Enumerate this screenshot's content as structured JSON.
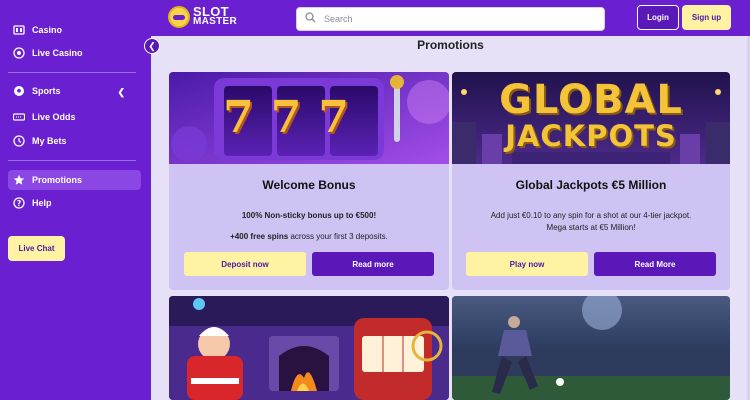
{
  "brand": {
    "line1": "SLOT",
    "line2": "MASTER"
  },
  "search": {
    "placeholder": "Search"
  },
  "auth": {
    "login_label": "Login",
    "signup_label": "Sign up"
  },
  "sidebar": {
    "items": [
      {
        "label": "Casino",
        "icon": "slot-machine-icon"
      },
      {
        "label": "Live Casino",
        "icon": "chip-icon"
      },
      {
        "label": "Sports",
        "icon": "soccer-ball-icon"
      },
      {
        "label": "Live Odds",
        "icon": "scoreboard-icon"
      },
      {
        "label": "My Bets",
        "icon": "clock-icon"
      },
      {
        "label": "Promotions",
        "icon": "star-icon"
      },
      {
        "label": "Help",
        "icon": "help-icon"
      }
    ],
    "live_chat_label": "Live Chat"
  },
  "page": {
    "title": "Promotions"
  },
  "promotions": [
    {
      "title": "Welcome Bonus",
      "line1": "100% Non-sticky bonus up to €500!",
      "line2_bold": "+400 free spins",
      "line2_rest": " across your first 3 deposits.",
      "primary_label": "Deposit now",
      "secondary_label": "Read more",
      "image_text": "777"
    },
    {
      "title": "Global Jackpots €5 Million",
      "line1": "Add just €0.10 to any spin for a shot at our 4-tier jackpot.",
      "line2": "Mega starts at €5 Million!",
      "primary_label": "Play now",
      "secondary_label": "Read More",
      "image_text_1": "GLOBAL",
      "image_text_2": "JACKPOTS"
    }
  ],
  "colors": {
    "brand_purple": "#6a1fd1",
    "accent_yellow": "#fff2a3",
    "card_bg": "#cfc3f4",
    "button_purple": "#5a18b9"
  }
}
